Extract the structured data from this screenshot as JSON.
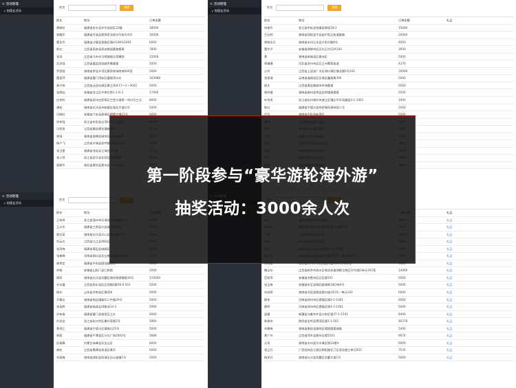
{
  "overlay": {
    "line1": "第一阶段参与“豪华游轮海外游”",
    "line2": "抽奖活动：3000余人次"
  },
  "windows": [
    {
      "id": "tl",
      "sidebar": {
        "menu": "活动管理",
        "submenu": "档案业活动"
      },
      "search": {
        "label": "姓名",
        "value": "",
        "button": "搜索"
      },
      "columns": [
        "姓名",
        "地址",
        "订单金额"
      ],
      "rows": [
        [
          "傅晓珍",
          "福建省宜丰县许尔部部区22幢",
          "18000"
        ],
        [
          "邹耀华",
          "福建省丹溪县星驿家汤家口号街号401",
          "16000"
        ],
        [
          "董吴华",
          "福建省沙塘县直路区镇村106号2001",
          "6000"
        ],
        [
          "陈红",
          "江西省高安县高安路园基路楼寓",
          "7800"
        ],
        [
          "张涛",
          "江西省马市村马将路楼诊家属院",
          "12000"
        ],
        [
          "艾忠强",
          "江西省嘉县团选路余春寓楼",
          "5000"
        ],
        [
          "罗国强",
          "湖南省罗县乡湾区赛家商场商城406室",
          "5000"
        ],
        [
          "董某萍",
          "福建省厦门湾安区霞楼湾头村",
          "163988"
        ],
        [
          "周兴伟",
          "江西省云县杭湖区康江湾乡17一1一3001",
          "5000"
        ],
        [
          "张群仙",
          "安徽省合江区中央庄院1-1-6-3",
          "17000"
        ],
        [
          "庄伟利",
          "福建省泉州白家第区兰堂沙道第一鸡口号三元",
          "8000"
        ],
        [
          "谭伯",
          "湖南省长沙县寺新路区城北大道口号",
          "5000"
        ],
        [
          "冯晓红",
          "安徽省六安县星城区朝鹭大镇15号",
          "6000"
        ],
        [
          "徐伟强",
          "浙江省东阳县吉湾村口王沿路号",
          "5000"
        ],
        [
          "冯思思",
          "江西省赣县横龙镇新铺村",
          "5000"
        ],
        [
          "郑强",
          "湖南省湘潭县城关区南京路口号",
          "5000"
        ],
        [
          "杨户飞",
          "江西省丰城县泉井镇百福路15号",
          "6000"
        ],
        [
          "张卫星",
          "福建省龙岩县王海区方兴路",
          "5000"
        ],
        [
          "张小萍",
          "浙江省金华县北苑区月湾楼盘",
          "5000"
        ],
        [
          "周建华",
          "湖北省黄冈县黄州区八一街14号",
          "5000"
        ]
      ]
    },
    {
      "id": "tr",
      "sidebar": {
        "menu": "活动管理",
        "submenu": "档案业活动"
      },
      "search": {
        "label": "姓名",
        "value": "",
        "button": "搜索"
      },
      "columns": [
        "姓名",
        "地址",
        "订单金额",
        "礼品"
      ],
      "rows": [
        [
          "何俊华",
          "浙江省余杭县钱塘县桃园18-2",
          "15000",
          ""
        ],
        [
          "兰元明",
          "湖南省邵阳县宁县庙宁阳江街道路路",
          "20000",
          ""
        ],
        [
          "胡胡志兵",
          "湖南省永州江永县夕彩村路8号",
          "4000",
          ""
        ],
        [
          "董冬子",
          "安徽省铜陵市区区州王村12#304",
          "3000",
          ""
        ],
        [
          "黄",
          "湖南省新城县区寨洲区",
          "5000",
          ""
        ],
        [
          "章珊珊",
          "河北省沧州市区区王州鹭蒋高速",
          "4370",
          ""
        ],
        [
          "占玲",
          "江西省上饶县广丰区湖口湖区镇北路5号202",
          "10000",
          ""
        ],
        [
          "张晋瑞",
          "云南省曲靖县区区城区鑫路寓300",
          "5000",
          ""
        ],
        [
          "顾文",
          "江西省黄县路城市市城雷通",
          "5000",
          ""
        ],
        [
          "胡玲珊",
          "湖南省郴州宜章县宜章镇寓楼楼",
          "5500",
          ""
        ],
        [
          "叶秀凤",
          "浙江省杭州湖村市澳江区镇庄华华苑路园3-1-1001",
          "1000",
          ""
        ],
        [
          "陈红",
          "福建省宁德沙县鸡桥镇同源林前二号",
          "2000",
          ""
        ],
        [
          "严华",
          "湖南省岳阳县新墙区",
          "5000",
          ""
        ],
        [
          "谭红",
          "江西省吉安县万安区",
          "3000",
          ""
        ],
        [
          "易伟",
          "湖南省长沙县开福区",
          "4000",
          ""
        ],
        [
          "伍平",
          "福建省三明县永安区",
          "5000",
          ""
        ],
        [
          "陈国",
          "江西省南昌县青山湖区",
          "6000",
          ""
        ],
        [
          "黄志",
          "湖南省株洲县荷塘区",
          "3000",
          ""
        ],
        [
          "罗芳",
          "福建省泉州县晋江区",
          "5000",
          ""
        ],
        [
          "唐敏",
          "湖南省衡阳县雁峰区",
          "4000",
          ""
        ]
      ]
    },
    {
      "id": "bl",
      "sidebar": {
        "menu": "活动管理",
        "submenu": "档案业活动"
      },
      "search": {
        "label": "姓名",
        "value": "",
        "button": "搜索"
      },
      "columns": [
        "姓名",
        "地址",
        "订单金额"
      ],
      "rows": [
        [
          "王有琴",
          "浙江省温州市乐清县北白象镇12号",
          "6000"
        ],
        [
          "王水华",
          "福建省三明县沙县城关镇30号",
          "5000"
        ],
        [
          "谢文英",
          "湖南省长沙县天心区湘江路12号",
          "5000"
        ],
        [
          "刘云方",
          "江西省九江县浔阳区",
          "5000"
        ],
        [
          "张雨梅",
          "福建省莆田县城厢区",
          "5000"
        ],
        [
          "张美梅",
          "河南省周口县沈丘槐店镇渡口街1号",
          "4772"
        ],
        [
          "谢孝定",
          "福建省平和县国强镇龙坑",
          "6000"
        ],
        [
          "徐畅",
          "安徽省山阳门县仁辉楼",
          "2000"
        ],
        [
          "周四",
          "湖南省长沙县岳麓区城东桃源镇楼30号",
          "110000"
        ],
        [
          "许永霞",
          "江西省南丰县区区地镇2路58-6-501",
          "5000"
        ],
        [
          "杨光",
          "山东省济南县区镇湾乡",
          "6000"
        ],
        [
          "尹春吉",
          "湖南省南县镇路北二中路20号",
          "5000"
        ],
        [
          "宋英辉",
          "福建省福清县湾路汤14-3",
          "2000"
        ],
        [
          "孙有香",
          "福建省厦门县湖里区江头",
          "6000"
        ],
        [
          "任凤龙",
          "浙江省杭州余区墨村家楼2号",
          "5900"
        ],
        [
          "黄柯仁",
          "福建省宁德沙区镇城口15号",
          "5000"
        ],
        [
          "林茜",
          "福建省平潭县区万众广场2003号",
          "5680"
        ],
        [
          "彭泰春",
          "内蒙古赤峰县元宝山区",
          "6000"
        ],
        [
          "胡欢",
          "江西省鹰潭县贵溪区寓号",
          "6000"
        ],
        [
          "刘清梅",
          "湖南省邵阳县双清区白公庙镇1号",
          "5000"
        ]
      ]
    },
    {
      "id": "br",
      "sidebar": {
        "menu": "活动管理",
        "submenu": "档案业活动"
      },
      "search": {
        "label": "姓名",
        "value": "",
        "button": "搜索"
      },
      "columns": [
        "姓名",
        "地址",
        "订单金额",
        "礼品"
      ],
      "rows": [
        [
          "陈兰",
          "湖南省醴陵市城区北路",
          "5000",
          "礼品"
        ],
        [
          "黄树林",
          "福建省福清县城区镇区朝露大公路12号",
          "5000",
          "礼品"
        ],
        [
          "卢青",
          "江西省抚州县临川区",
          "26274",
          "礼品"
        ],
        [
          "孙杰",
          "浙江省宁波县北仑区",
          "5000",
          "礼品"
        ],
        [
          "曾欣",
          "福建省泉州县丰泽区桥口号1102室",
          "5000",
          "礼品"
        ],
        [
          "田小铭",
          "湖北省荆州沙县楼路大路185号一单元502室",
          "4700",
          "礼品"
        ],
        [
          "黄钰敏",
          "湖北省荆州沙市区湖路大路185号1102室",
          "4500",
          "礼品"
        ],
        [
          "魏士钦",
          "江西省新余市渝水区城北街道湖陵江南区10号楼1单元302室",
          "14000",
          "礼品"
        ],
        [
          "范丽萍",
          "安徽省合肥市区区区楼501",
          "5000",
          "礼品"
        ],
        [
          "张玉梅",
          "安徽省东至县城北路湖南1栋3单4号",
          "5000",
          "礼品"
        ],
        [
          "刘成荣",
          "湖南省岳阳县楼县楼口道102号一单元102",
          "6000",
          "礼品"
        ],
        [
          "薛伟",
          "河南省郑州市区楼镇区楼4-2-1001",
          "6000",
          "礼品"
        ],
        [
          "薛明",
          "河南省郑州市区楼镇区楼4-2-1001",
          "5000",
          "礼品"
        ],
        [
          "梁健",
          "新疆县乌鲁木齐县沙依区楼37-1-1501",
          "8400",
          "礼品"
        ],
        [
          "陈建伟",
          "陕西省宝鸡县渭滨区楼2-1-501",
          "46378",
          "礼品"
        ],
        [
          "刘春梅",
          "湖南省衡阳县珠晖区楼楼楼楼城路",
          "5400",
          "礼品"
        ],
        [
          "黄广州",
          "江西省萍乡县湘东区楼5501",
          "6674",
          "礼品"
        ],
        [
          "沙亮",
          "湖南省永州县冷水滩区楼12楼4",
          "6000",
          "礼品"
        ],
        [
          "张立兵",
          "广西桂林县七星区朝阳路北汀区滨北路三单元502",
          "7535",
          "礼品"
        ],
        [
          "杨秀芬",
          "湖南省长沙县岳麓区岳麓大道1号",
          "5000",
          "礼品"
        ]
      ]
    }
  ]
}
